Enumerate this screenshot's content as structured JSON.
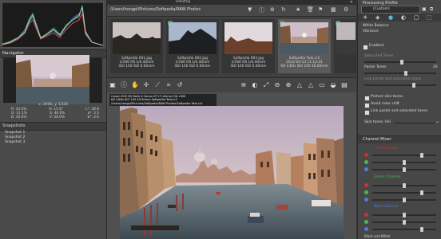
{
  "window": {
    "path": "/Users/hongpl/Pictures/Softpedia/RAW Photos",
    "center_title": "Filmstrip"
  },
  "left": {
    "navigator_label": "Navigator",
    "readout": "x: 2606, y: 1328",
    "info": [
      [
        "R: 34.0%",
        "H: 15.6°",
        "L*: 38.8"
      ],
      [
        "G: 31.1%",
        "S: 40.0%",
        "a*: 3.5"
      ],
      [
        "B: 30.0%",
        "V: 34.0%",
        "b*: 4.6"
      ]
    ],
    "snapshots_label": "Snapshots",
    "snapshots": [
      "Snapshot 1",
      "Snapshot 2",
      "Snapshot 3"
    ]
  },
  "filmstrip": [
    {
      "name": "Softpedia 001.jpg",
      "line2": "1/500 f/8 1/0.40mm",
      "line3": "ISO 100 ISO 0.00mm",
      "selected": false,
      "checked": false
    },
    {
      "name": "Softpedia 002.jpg",
      "line2": "1/500 f/8 1/0.40mm",
      "line3": "ISO 100 ISO 0.00mm",
      "selected": false,
      "checked": true
    },
    {
      "name": "Softpedia 003.jpg",
      "line2": "1/500 f/8 1/0.40mm",
      "line3": "ISO 100 ISO 0.00mm",
      "selected": false,
      "checked": false
    },
    {
      "name": "Softpedia Test.cr2",
      "line2": "2012-04-13 11:12:41",
      "line3": "f/8 1/60s ISO 100 40.00mm",
      "selected": true,
      "checked": true
    }
  ],
  "image_info": {
    "line1": "Canon EOS 5D Mark II  Canon EF 17-40mm f/4L USM",
    "line2": "f/8  1/60s  ISO 100  40.00mm  Softpedia Test.cr2",
    "line3": "/Users/hongpl/Pictures/Softpedia/RAW Photos/Softpedia Test.cr2"
  },
  "right": {
    "title": "Processing Profile",
    "profile_value": "(Custom)",
    "white_balance_label": "White Balance",
    "vibrance_label": "Vibrance",
    "enabled_label": "Enabled",
    "saturated_tones_label": "Saturated Tones",
    "pastel_tones_label": "Pastel Tones",
    "pastel_value": "26",
    "link_label": "Link pastel and saturated tones",
    "protect_skin": "Protect skin tones",
    "avoid_shift": "Avoid color shift",
    "link_pastel": "Link pastel and saturated tones",
    "skin_tones_label": "Skin tones",
    "skin_tones_value": "HH",
    "channel_mixer_label": "Channel Mixer",
    "red_label": "Red Channel",
    "green_label": "Green Channel",
    "blue_label": "Blue Channel",
    "black_white_label": "Black and White"
  },
  "colors": {
    "accent_green": "#3aa35a",
    "red": "#d03030",
    "green": "#46b65a",
    "blue": "#4f7fd8"
  }
}
